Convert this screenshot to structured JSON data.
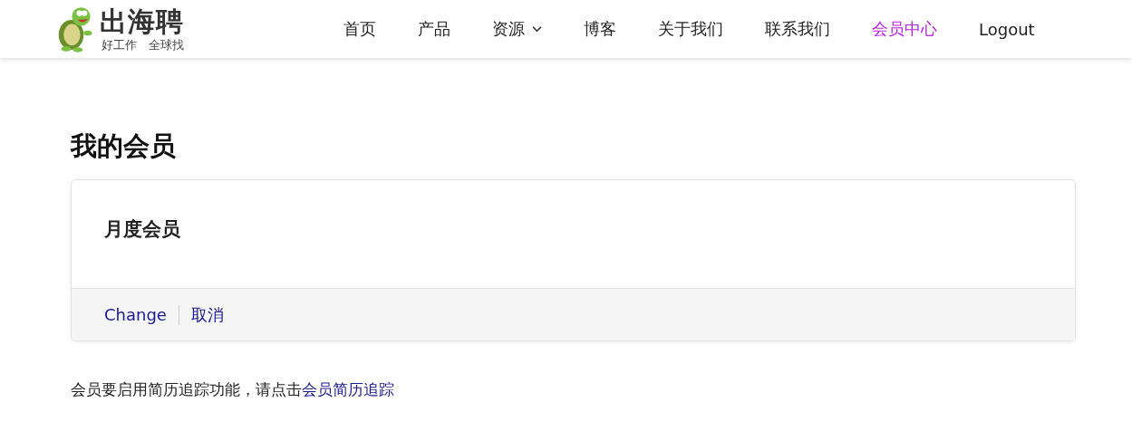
{
  "logo": {
    "name": "出海聘",
    "tagline": "好工作　全球找"
  },
  "nav": [
    {
      "label": "首页",
      "selected": false,
      "kind": "link"
    },
    {
      "label": "产品",
      "selected": false,
      "kind": "link"
    },
    {
      "label": "资源",
      "selected": false,
      "kind": "dropdown"
    },
    {
      "label": "博客",
      "selected": false,
      "kind": "link"
    },
    {
      "label": "关于我们",
      "selected": false,
      "kind": "link"
    },
    {
      "label": "联系我们",
      "selected": false,
      "kind": "link"
    },
    {
      "label": "会员中心",
      "selected": true,
      "kind": "link"
    },
    {
      "label": "Logout",
      "selected": false,
      "kind": "link"
    }
  ],
  "page_title": "我的会员",
  "membership": {
    "plan": "月度会员",
    "actions": [
      "Change",
      "取消"
    ]
  },
  "notice": {
    "text": "会员要启用简历追踪功能，请点击",
    "link": "会员简历追踪"
  }
}
